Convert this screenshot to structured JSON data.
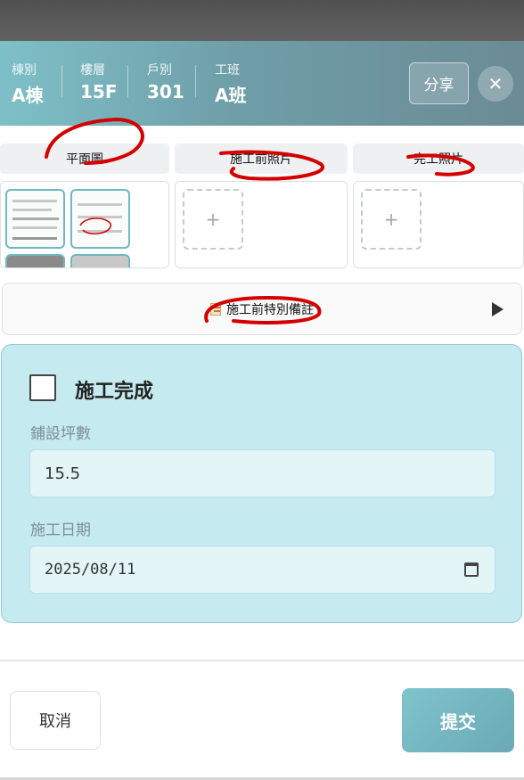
{
  "header": {
    "fields": [
      {
        "label": "棟別",
        "value": "A棟"
      },
      {
        "label": "樓層",
        "value": "15F"
      },
      {
        "label": "戶別",
        "value": "301"
      },
      {
        "label": "工班",
        "value": "A班"
      }
    ],
    "share_label": "分享",
    "close_label": "✕"
  },
  "tabs": [
    {
      "label": "平面圖"
    },
    {
      "label": "施工前照片"
    },
    {
      "label": "完工照片"
    }
  ],
  "add_label": "+",
  "notes": {
    "label": "施工前特別備註"
  },
  "form": {
    "done_label": "施工完成",
    "area_label": "鋪設坪數",
    "area_value": "15.5",
    "date_label": "施工日期",
    "date_value": "2025/08/11"
  },
  "footer": {
    "cancel_label": "取消",
    "submit_label": "提交"
  },
  "colors": {
    "accent": "#6fb9c2",
    "card_bg": "#c5eaef",
    "annotation_red": "#d40000"
  }
}
